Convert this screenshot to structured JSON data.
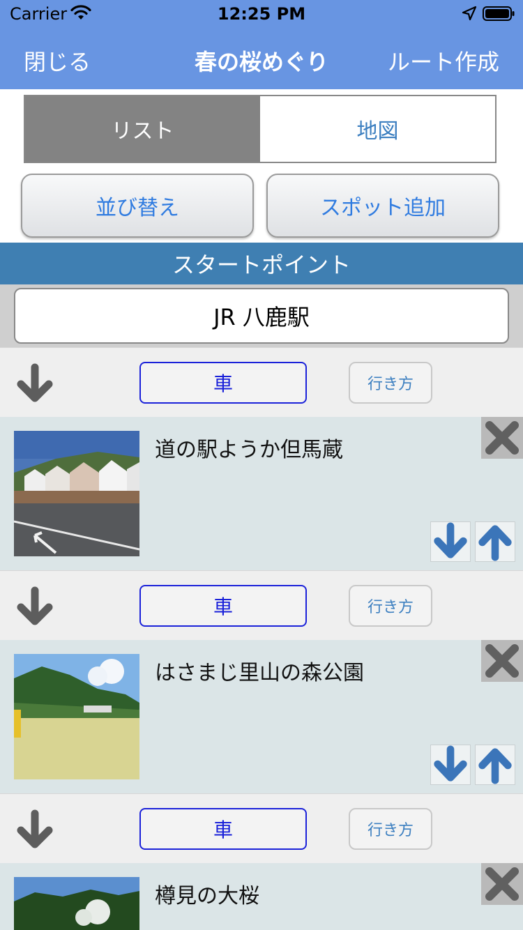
{
  "status_bar": {
    "carrier": "Carrier",
    "time": "12:25 PM"
  },
  "nav": {
    "close": "閉じる",
    "title": "春の桜めぐり",
    "route": "ルート作成"
  },
  "segment": {
    "list": "リスト",
    "map": "地図",
    "selected": "リスト"
  },
  "actions": {
    "sort": "並び替え",
    "add_spot": "スポット追加"
  },
  "start": {
    "header": "スタートポイント",
    "value": "JR 八鹿駅"
  },
  "legs": [
    {
      "mode": "車",
      "howto": "行き方"
    },
    {
      "mode": "車",
      "howto": "行き方"
    },
    {
      "mode": "車",
      "howto": "行き方"
    }
  ],
  "spots": [
    {
      "name": "道の駅ようか但馬蔵"
    },
    {
      "name": "はさまじ里山の森公園"
    },
    {
      "name": "樽見の大桜"
    }
  ],
  "colors": {
    "nav_bg": "#6895e2",
    "section_bar": "#3f7fb2",
    "spot_bg": "#dbe5e7",
    "mode_border": "#1a21d9",
    "arrow_blue": "#3b75b9"
  },
  "icons": [
    "wifi-icon",
    "location-arrow-icon",
    "battery-icon",
    "arrow-down-icon",
    "close-x-icon",
    "arrow-up-icon"
  ]
}
